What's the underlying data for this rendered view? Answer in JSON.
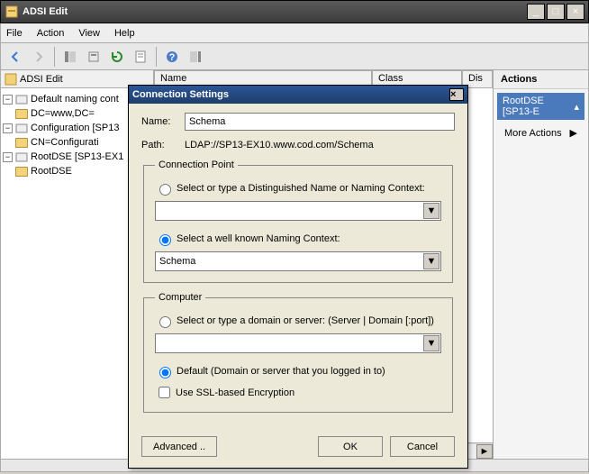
{
  "window": {
    "title": "ADSI Edit",
    "min": "_",
    "max": "□",
    "close": "×"
  },
  "menu": {
    "file": "File",
    "action": "Action",
    "view": "View",
    "help": "Help"
  },
  "tree": {
    "header": "ADSI Edit",
    "root": "ADSI Edit",
    "items": [
      {
        "label": "Default naming cont"
      },
      {
        "label": "DC=www,DC="
      },
      {
        "label": "Configuration [SP13"
      },
      {
        "label": "CN=Configurati"
      },
      {
        "label": "RootDSE [SP13-EX1"
      },
      {
        "label": "RootDSE"
      }
    ]
  },
  "list": {
    "col_name": "Name",
    "col_class": "Class",
    "col_dis": "Dis"
  },
  "actions": {
    "title": "Actions",
    "selected": "RootDSE [SP13-E",
    "more": "More Actions"
  },
  "dialog": {
    "title": "Connection Settings",
    "close": "×",
    "name_label": "Name:",
    "name_value": "Schema",
    "path_label": "Path:",
    "path_value": "LDAP://SP13-EX10.www.cod.com/Schema",
    "cp_legend": "Connection Point",
    "cp_radio1": "Select or type a Distinguished Name or Naming Context:",
    "cp_radio2": "Select a well known Naming Context:",
    "cp_combo2_value": "Schema",
    "comp_legend": "Computer",
    "comp_radio1": "Select or type a domain or server: (Server | Domain [:port])",
    "comp_radio2": "Default (Domain or server that you logged in to)",
    "ssl_label": "Use SSL-based Encryption",
    "advanced": "Advanced ..",
    "ok": "OK",
    "cancel": "Cancel"
  }
}
